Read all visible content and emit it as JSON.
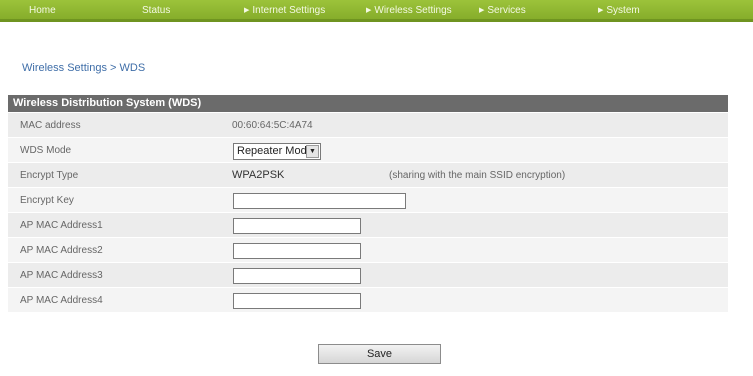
{
  "nav": {
    "home": "Home",
    "status": "Status",
    "internet": "Internet Settings",
    "wireless": "Wireless Settings",
    "services": "Services",
    "system": "System"
  },
  "breadcrumb": "Wireless Settings > WDS",
  "panel_title": "Wireless Distribution System (WDS)",
  "fields": {
    "mac_label": "MAC address",
    "mac_value": "00:60:64:5C:4A74",
    "wds_mode_label": "WDS Mode",
    "wds_mode_value": "Repeater Mode",
    "encrypt_type_label": "Encrypt Type",
    "encrypt_type_value": "WPA2PSK",
    "encrypt_type_note": "(sharing with the main SSID encryption)",
    "encrypt_key_label": "Encrypt Key",
    "encrypt_key_value": "",
    "ap1_label": "AP MAC Address1",
    "ap1_value": "",
    "ap2_label": "AP MAC Address2",
    "ap2_value": "",
    "ap3_label": "AP MAC Address3",
    "ap3_value": "",
    "ap4_label": "AP MAC Address4",
    "ap4_value": ""
  },
  "save_label": "Save",
  "icons": {
    "nav_arrow": "triangle-right-icon",
    "select_arrow": "triangle-down-icon"
  },
  "colors": {
    "nav_green": "#8fb833",
    "header_gray": "#6b6b6b",
    "link_blue": "#3f6ea8"
  }
}
